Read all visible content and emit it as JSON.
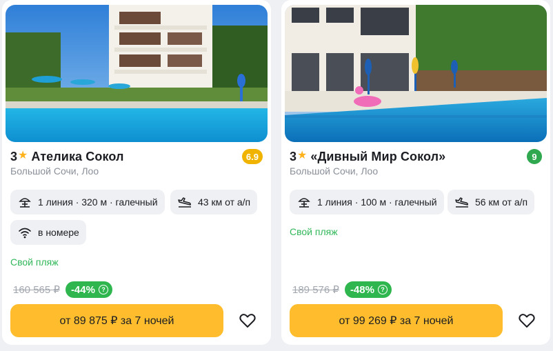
{
  "cards": [
    {
      "stars": "3",
      "name": "Ателика Сокол",
      "rating": "6.9",
      "location": "Большой Сочи, Лоо",
      "beach_feature": "1 линия · 320 м · галечный",
      "airport_feature": "43 км от а/п",
      "wifi_feature": "в номере",
      "own_beach": "Свой пляж",
      "old_price": "160 565 ₽",
      "discount": "-44%",
      "button_label": "от 89 875 ₽ за 7 ночей"
    },
    {
      "stars": "3",
      "name": "«Дивный Мир Сокол»",
      "rating": "9",
      "location": "Большой Сочи, Лоо",
      "beach_feature": "1 линия · 100 м · галечный",
      "airport_feature": "56 км от а/п",
      "own_beach": "Свой пляж",
      "old_price": "189 576 ₽",
      "discount": "-48%",
      "button_label": "от 99 269 ₽ за 7 ночей"
    }
  ],
  "icons": {
    "star": "star-icon",
    "beach": "beach-umbrella-icon",
    "airport": "airplane-landing-icon",
    "wifi": "wifi-icon",
    "info": "info-icon",
    "favorite": "heart-icon"
  },
  "colors": {
    "star": "#ffb21c",
    "rating_amber": "#f0b400",
    "rating_green": "#2fa84f",
    "discount": "#2fb64f",
    "own_beach": "#31b75a",
    "button": "#ffbd2e"
  }
}
